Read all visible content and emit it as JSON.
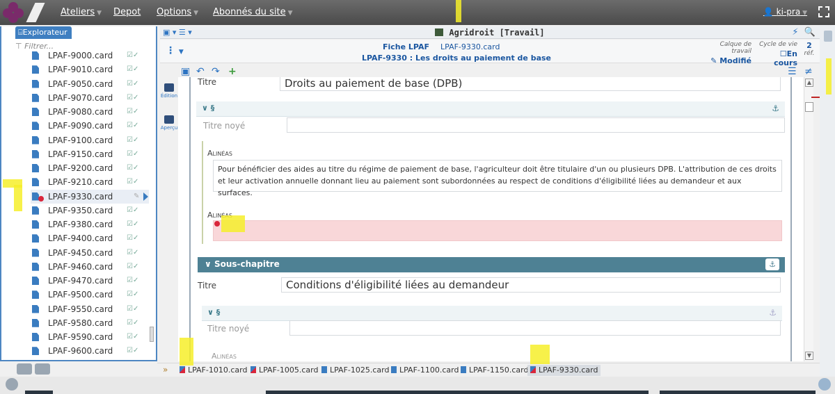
{
  "topbar": {
    "menus": [
      "Ateliers",
      "Depot",
      "Options",
      "Abonnés du site"
    ],
    "user": "ki-pra"
  },
  "explorer": {
    "tab_label": "Explorateur",
    "filter_placeholder": "Filtrer...",
    "files": [
      "LPAF-9000.card",
      "LPAF-9010.card",
      "LPAF-9050.card",
      "LPAF-9070.card",
      "LPAF-9080.card",
      "LPAF-9090.card",
      "LPAF-9100.card",
      "LPAF-9150.card",
      "LPAF-9200.card",
      "LPAF-9210.card",
      "LPAF-9330.card",
      "LPAF-9350.card",
      "LPAF-9380.card",
      "LPAF-9400.card",
      "LPAF-9450.card",
      "LPAF-9460.card",
      "LPAF-9470.card",
      "LPAF-9500.card",
      "LPAF-9550.card",
      "LPAF-9580.card",
      "LPAF-9590.card",
      "LPAF-9600.card"
    ],
    "selected": "LPAF-9330.card"
  },
  "editor": {
    "title": "Agridroit [Travail]",
    "fiche_label": "Fiche LPAF",
    "fiche_file": "LPAF-9330.card",
    "fiche_subtitle": "LPAF-9330 : Les droits au paiement de base",
    "calque_label": "Calque de travail",
    "calque_value": "Modifié",
    "cycle_label": "Cycle de vie",
    "cycle_value": "En cours",
    "refs_count": "2",
    "refs_label": "réf.",
    "side_edition": "Édition",
    "side_apercu": "Aperçu"
  },
  "content": {
    "titre_label": "Titre",
    "titre_value": "Droits au paiement de base (DPB)",
    "section_symbol": "§",
    "titre_noye_label": "Titre noyé",
    "alineas_label": "Alinéas",
    "alinea_text": "Pour bénéficier des aides au titre du régime de paiement de base, l'agriculteur doit être titulaire d'un ou plusieurs DPB. L'attribution de ces droits et leur activation annuelle donnant lieu au paiement sont subordonnées au respect de conditions d'éligibilité liées au demandeur et aux surfaces.",
    "sous_chapitre_label": "Sous-chapitre",
    "sous_titre_value": "Conditions d'éligibilité liées au demandeur"
  },
  "tabs": [
    "LPAF-1010.card",
    "LPAF-1005.card",
    "LPAF-1025.card",
    "LPAF-1100.card",
    "LPAF-1150.card",
    "LPAF-9330.card"
  ],
  "colors": {
    "accent": "#2d74c2",
    "section_teal": "#4e8194",
    "error_pink": "#f9d7d9",
    "highlight": "#f6ef2a"
  }
}
